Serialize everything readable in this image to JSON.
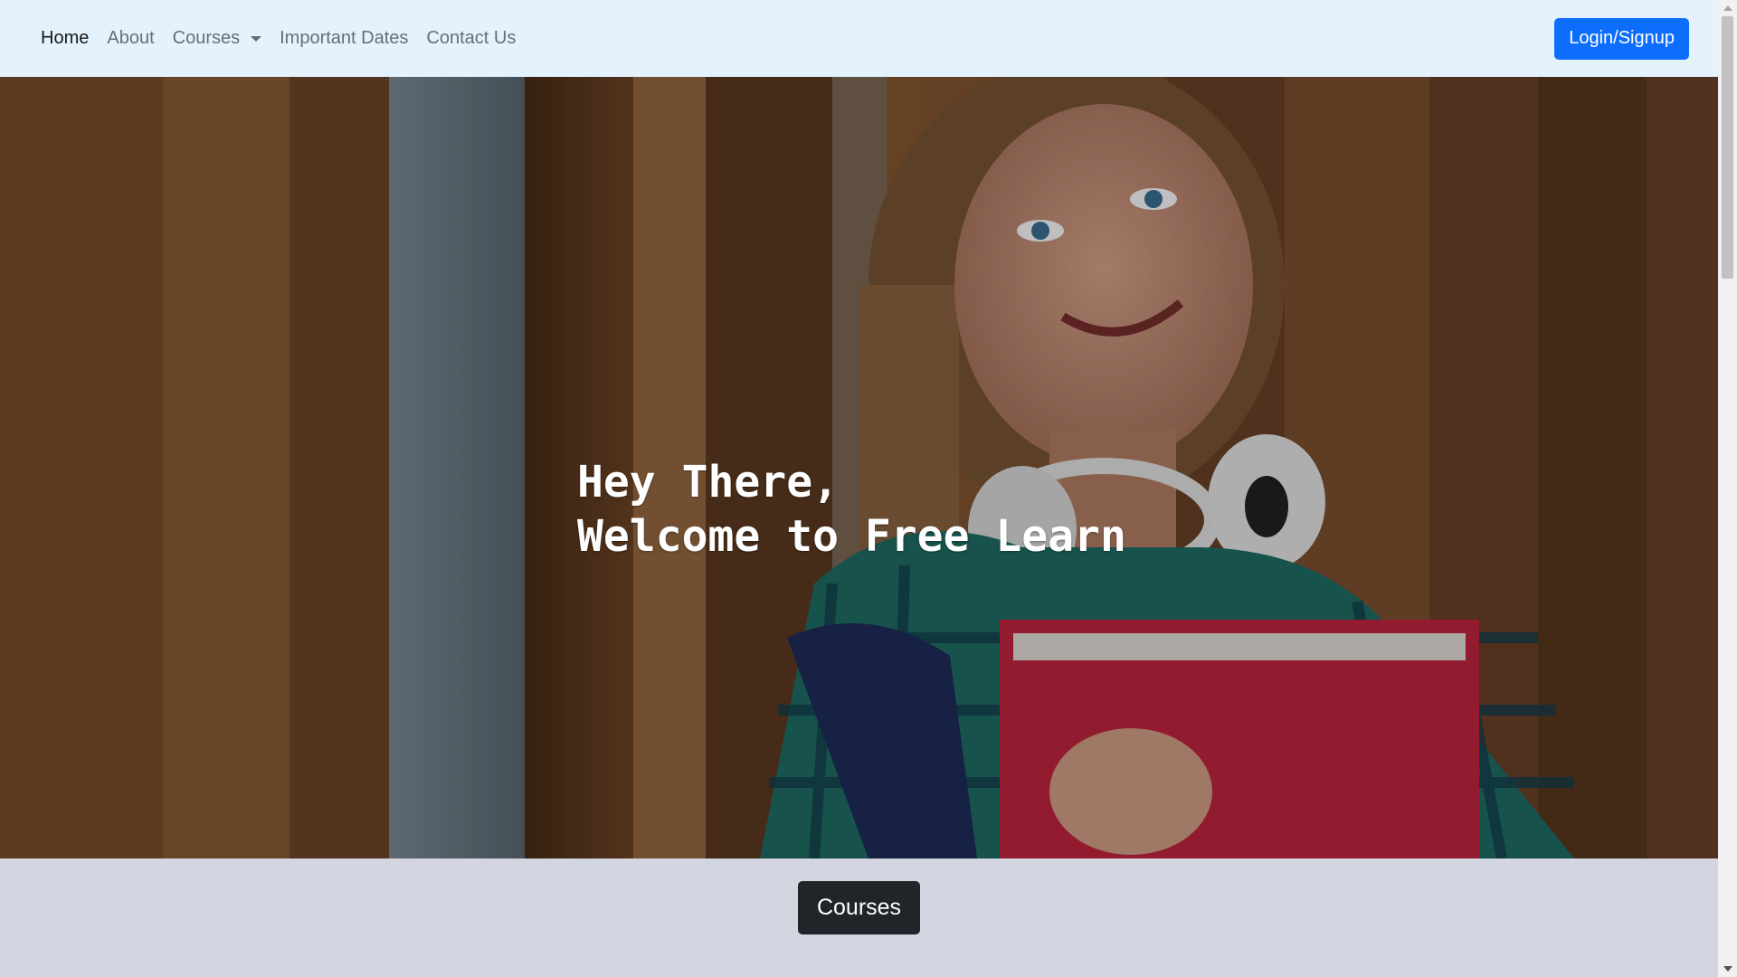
{
  "nav": {
    "items": [
      {
        "label": "Home",
        "active": true
      },
      {
        "label": "About"
      },
      {
        "label": "Courses",
        "dropdown": true
      },
      {
        "label": "Important Dates"
      },
      {
        "label": "Contact Us"
      }
    ],
    "login_label": "Login/Signup"
  },
  "hero": {
    "line1": "Hey There,",
    "line2": "Welcome to Free Learn"
  },
  "section": {
    "courses_button": "Courses"
  },
  "colors": {
    "navbar_bg": "#e3f2fd",
    "primary": "#0d6efd",
    "dark": "#212529",
    "section_bg": "#d3d6e1"
  }
}
